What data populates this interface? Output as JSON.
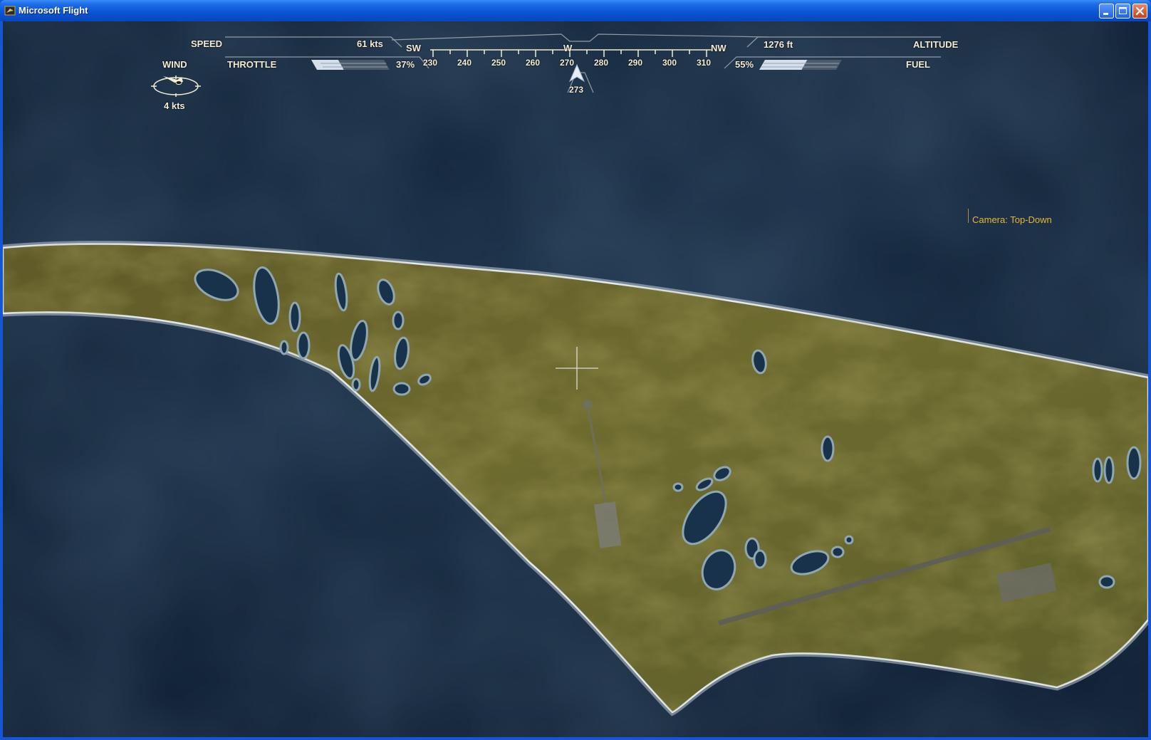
{
  "window": {
    "title": "Microsoft Flight",
    "buttons": {
      "minimize": "minimize-icon",
      "maximize": "maximize-icon",
      "close": "close-icon"
    }
  },
  "hud": {
    "speed": {
      "label": "SPEED",
      "value": "61 kts"
    },
    "altitude": {
      "label": "ALTITUDE",
      "value": "1276 ft"
    },
    "throttle": {
      "label": "THROTTLE",
      "value": "37%",
      "level": 0.37
    },
    "fuel": {
      "label": "FUEL",
      "value": "55%",
      "level": 0.55
    },
    "wind": {
      "label": "WIND",
      "value": "4  kts",
      "icon": "wind-compass-icon"
    },
    "compass": {
      "cardinals": [
        "SW",
        "W",
        "NW"
      ],
      "ticks": [
        "230",
        "240",
        "250",
        "260",
        "270",
        "280",
        "290",
        "300",
        "310"
      ],
      "heading": "273",
      "heading_marker_icon": "heading-arrow-icon"
    },
    "crosshair_icon": "crosshair-icon"
  },
  "camera": {
    "label": "Camera: Top-Down"
  },
  "colors": {
    "hud_text": "#f3edd6",
    "camera_text": "#e8b638",
    "ocean": "#14283f",
    "land": "#6b6a2c",
    "titlebar": "#0a55d8"
  }
}
